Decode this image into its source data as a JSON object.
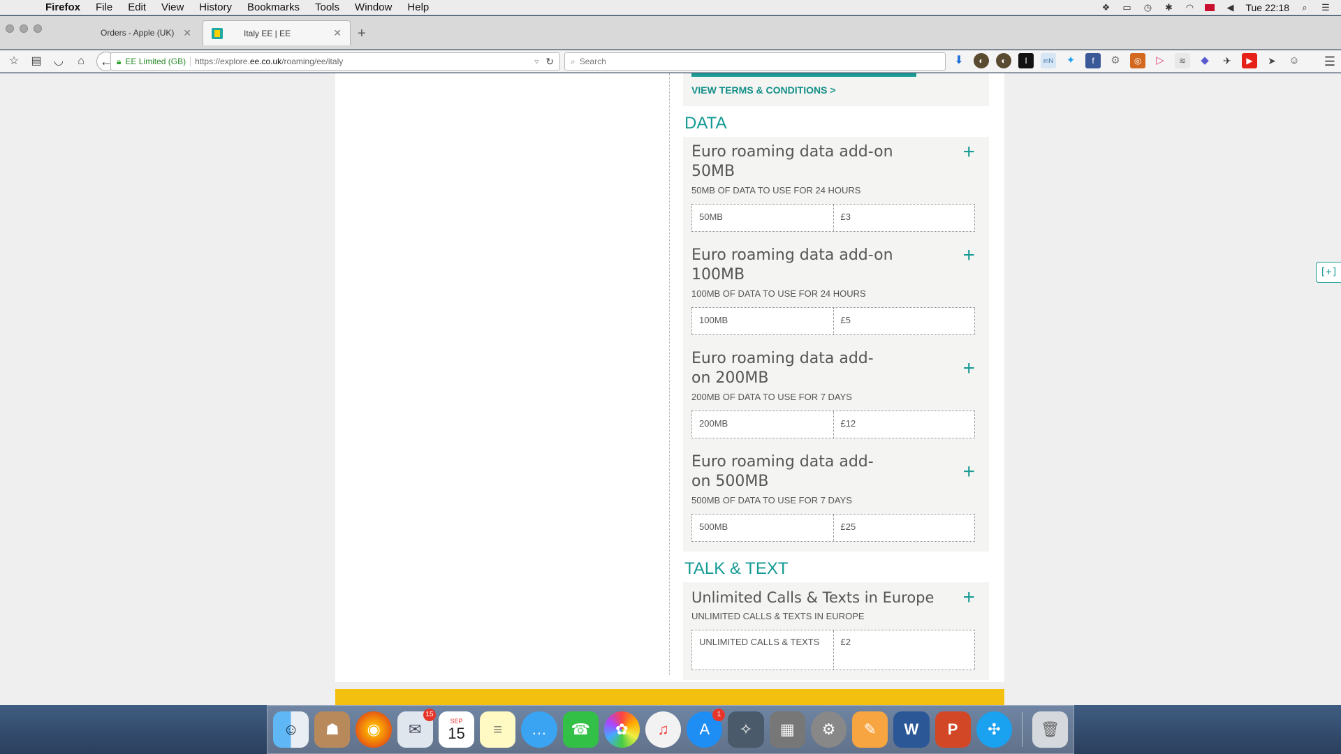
{
  "menubar": {
    "app": "Firefox",
    "items": [
      "File",
      "Edit",
      "View",
      "History",
      "Bookmarks",
      "Tools",
      "Window",
      "Help"
    ],
    "clock": "Tue 22:18"
  },
  "tabs": [
    {
      "title": "Orders - Apple (UK)"
    },
    {
      "title": "Italy EE | EE"
    }
  ],
  "navbar": {
    "identity": "EE Limited (GB)",
    "url_prefix": "https://explore.",
    "url_domain": "ee.co.uk",
    "url_path": "/roaming/ee/italy",
    "search_placeholder": "Search"
  },
  "page": {
    "terms_link": "VIEW TERMS & CONDITIONS >",
    "sections": [
      {
        "heading": "DATA",
        "addons": [
          {
            "title": "Euro roaming data add-on 50MB",
            "subtitle": "50MB OF DATA TO USE FOR 24 HOURS",
            "allowance": "50MB",
            "price": "£3"
          },
          {
            "title": "Euro roaming data add-on 100MB",
            "subtitle": "100MB OF DATA TO USE FOR 24 HOURS",
            "allowance": "100MB",
            "price": "£5"
          },
          {
            "title": "Euro roaming data add-on 200MB",
            "subtitle": "200MB OF DATA TO USE FOR 7 DAYS",
            "allowance": "200MB",
            "price": "£12"
          },
          {
            "title": "Euro roaming data add-on 500MB",
            "subtitle": "500MB OF DATA TO USE FOR 7 DAYS",
            "allowance": "500MB",
            "price": "£25"
          }
        ]
      },
      {
        "heading": "TALK & TEXT",
        "addons": [
          {
            "title": "Unlimited Calls & Texts in Europe",
            "subtitle": "UNLIMITED CALLS & TEXTS IN EUROPE",
            "allowance": "UNLIMITED CALLS & TEXTS",
            "price": "£2"
          }
        ]
      }
    ],
    "side_widget": "[+]"
  },
  "dock": {
    "calendar_month": "SEP",
    "calendar_day": "15",
    "mail_badge": "15",
    "appstore_badge": "1"
  },
  "colors": {
    "ee_teal": "#1a9c95",
    "ee_yellow": "#f4c00f"
  }
}
